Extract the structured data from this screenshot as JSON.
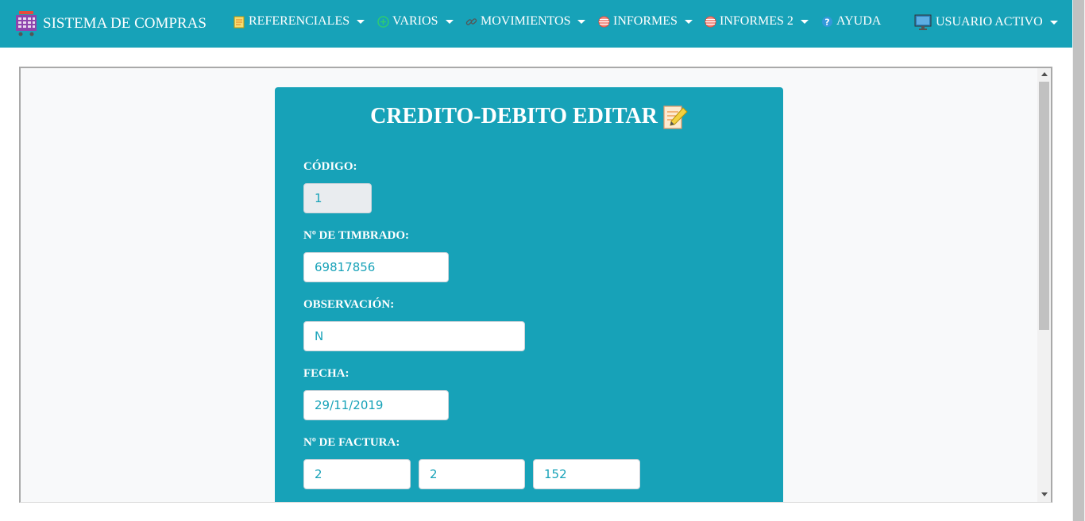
{
  "navbar": {
    "brand": "SISTEMA DE COMPRAS",
    "items": [
      {
        "label": "REFERENCIALES",
        "icon": "notepad-icon"
      },
      {
        "label": "VARIOS",
        "icon": "plus-circle-icon"
      },
      {
        "label": "MOVIMIENTOS",
        "icon": "link-icon"
      },
      {
        "label": "INFORMES",
        "icon": "globe-icon"
      },
      {
        "label": "INFORMES 2",
        "icon": "globe-icon"
      },
      {
        "label": "AYUDA",
        "icon": "help-icon"
      }
    ],
    "user": "USUARIO ACTIVO"
  },
  "form": {
    "title": "CREDITO-DEBITO EDITAR",
    "codigo_label": "CÓDIGO:",
    "codigo_value": "1",
    "timbrado_label": "Nº DE TIMBRADO:",
    "timbrado_value": "69817856",
    "observacion_label": "OBSERVACIÓN:",
    "observacion_value": "N",
    "fecha_label": "FECHA:",
    "fecha_value": "29/11/2019",
    "factura_label": "Nº DE FACTURA:",
    "factura_1": "2",
    "factura_2": "2",
    "factura_3": "152"
  },
  "colors": {
    "accent": "#17a2b8",
    "frame_bg": "#f8f9fa"
  }
}
